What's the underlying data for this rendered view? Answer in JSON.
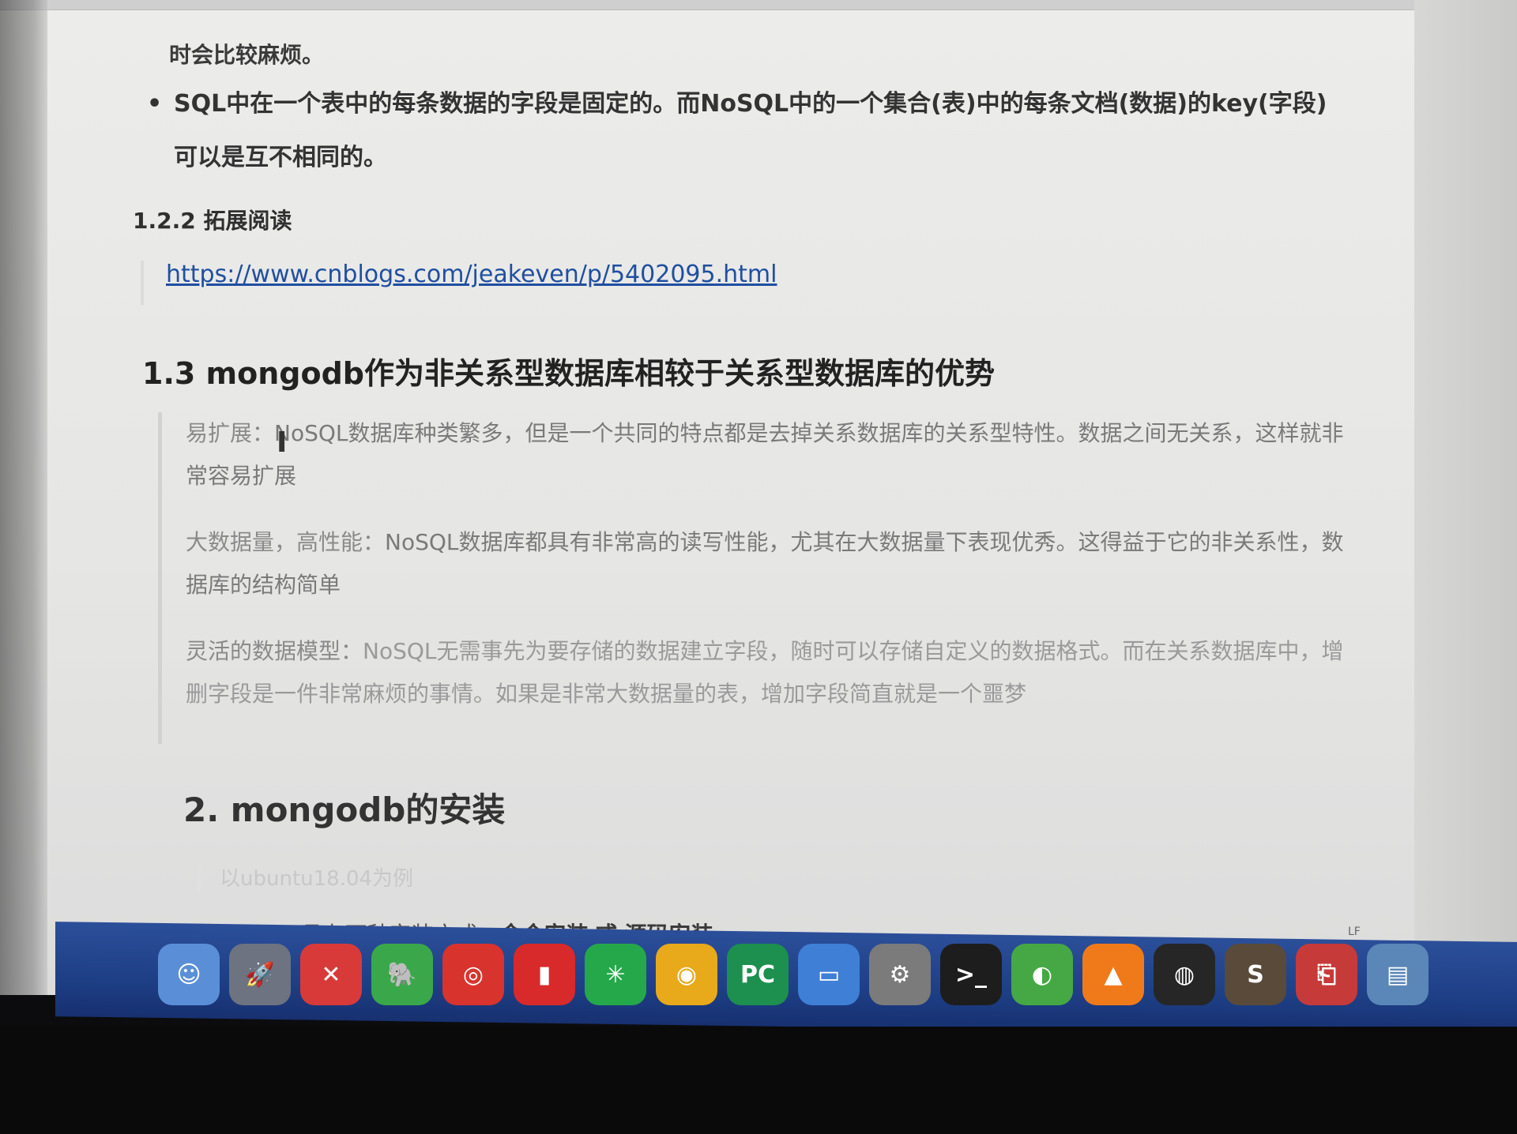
{
  "doc": {
    "para_tail": "时会比较麻烦。",
    "bullet_text": "SQL中在一个表中的每条数据的字段是固定的。而NoSQL中的一个集合(表)中的每条文档(数据)的key(字段)可以是互不相同的。",
    "heading_1_2_2": "1.2.2 拓展阅读",
    "link": "https://www.cnblogs.com/jeakeven/p/5402095.html",
    "heading_1_3": "1.3 mongodb作为非关系型数据库相较于关系型数据库的优势",
    "quote": [
      {
        "lead": "易扩展：",
        "text": "NoSQL数据库种类繁多，但是一个共同的特点都是去掉关系数据库的关系型特性。数据之间无关系，这样就非常容易扩展"
      },
      {
        "lead": "大数据量，高性能：",
        "text": "NoSQL数据库都具有非常高的读写性能，尤其在大数据量下表现优秀。这得益于它的非关系性，数据库的结构简单"
      },
      {
        "lead": "灵活的数据模型：",
        "text": "NoSQL无需事先为要存储的数据建立字段，随时可以存储自定义的数据格式。而在关系数据库中，增删字段是一件非常麻烦的事情。如果是非常大数据量的表，增加字段简直就是一个噩梦"
      }
    ],
    "heading_2": "2. mongodb的安装",
    "note": "以ubuntu18.04为例",
    "install_prefix": "mongodb具有两种安装方式：",
    "install_opt1": "命令安装",
    "install_or": "或",
    "install_opt2": "源码安装"
  },
  "status_bar": {
    "encoding": "LF"
  },
  "dock": {
    "icons": [
      {
        "name": "finder-icon",
        "glyph": "☺",
        "color": "#5a8fd8"
      },
      {
        "name": "launchpad-icon",
        "glyph": "🚀",
        "color": "#6d7380"
      },
      {
        "name": "xmind-icon",
        "glyph": "✕",
        "color": "#d83a3a"
      },
      {
        "name": "evernote-icon",
        "glyph": "🐘",
        "color": "#3aa84a"
      },
      {
        "name": "netease-music-icon",
        "glyph": "◎",
        "color": "#d9332e"
      },
      {
        "name": "audio-app-icon",
        "glyph": "▮",
        "color": "#d82a2a"
      },
      {
        "name": "network-icon",
        "glyph": "✳",
        "color": "#25a84a"
      },
      {
        "name": "chrome-icon",
        "glyph": "◉",
        "color": "#e8a91a"
      },
      {
        "name": "pycharm-icon",
        "glyph": "PC",
        "color": "#1d8f4f"
      },
      {
        "name": "keynote-icon",
        "glyph": "▭",
        "color": "#3f7fd6"
      },
      {
        "name": "system-preferences-icon",
        "glyph": "⚙",
        "color": "#7b7b7b"
      },
      {
        "name": "terminal-icon",
        "glyph": ">_",
        "color": "#1d1d1d"
      },
      {
        "name": "app-green-icon",
        "glyph": "◐",
        "color": "#46a845"
      },
      {
        "name": "vlc-icon",
        "glyph": "▲",
        "color": "#f07a1a"
      },
      {
        "name": "obs-icon",
        "glyph": "◍",
        "color": "#262626"
      },
      {
        "name": "sublime-icon",
        "glyph": "S",
        "color": "#5a4a3a"
      },
      {
        "name": "app-red-icon",
        "glyph": "⎗",
        "color": "#c63a3a"
      },
      {
        "name": "preview-icon",
        "glyph": "▤",
        "color": "#5a86b8"
      }
    ]
  }
}
